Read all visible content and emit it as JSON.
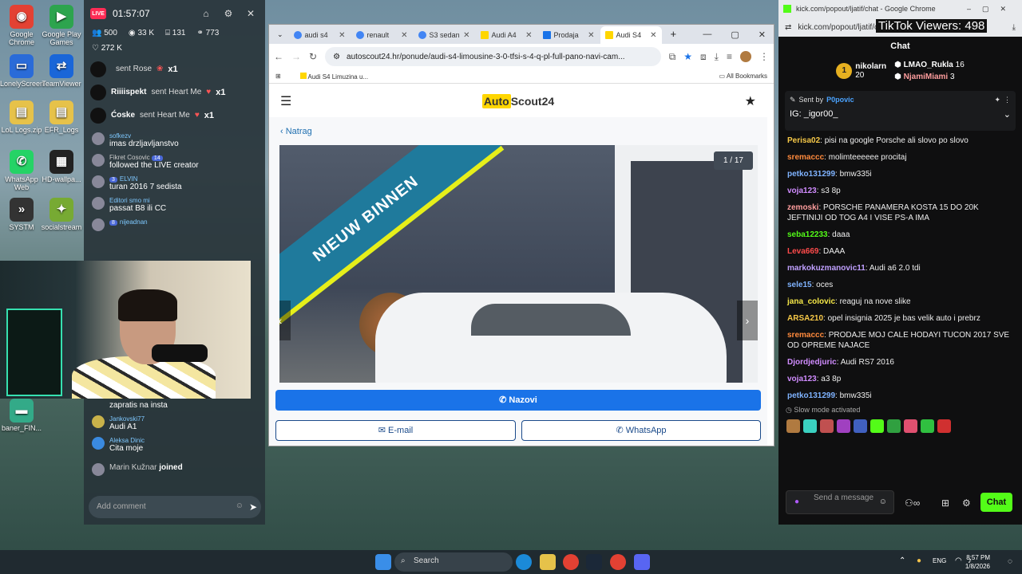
{
  "desktop": {
    "icons": [
      {
        "label": "Google Chrome",
        "color": "#e34133",
        "glyph": "◉"
      },
      {
        "label": "Google Play Games",
        "color": "#2da44e",
        "glyph": "▶"
      },
      {
        "label": "LonelyScreen",
        "color": "#2a6bd8",
        "glyph": "▭"
      },
      {
        "label": "TeamViewer",
        "color": "#1a66d8",
        "glyph": "⇄"
      },
      {
        "label": "LoL Logs.zip",
        "color": "#e6c24a",
        "glyph": "▤"
      },
      {
        "label": "EFR_Logs",
        "color": "#e6c24a",
        "glyph": "▤"
      },
      {
        "label": "WhatsApp Web",
        "color": "#25d366",
        "glyph": "✆"
      },
      {
        "label": "HD-wallpa...",
        "color": "#222",
        "glyph": "▦"
      },
      {
        "label": "SYSTM",
        "color": "#333",
        "glyph": "»"
      },
      {
        "label": "socialstream",
        "color": "#7a3",
        "glyph": "✦"
      },
      {
        "label": "baner_FIN...",
        "color": "#3a8",
        "glyph": "▬"
      }
    ]
  },
  "tiktok": {
    "live": "LIVE",
    "time": "01:57:07",
    "stats": {
      "viewers": "500",
      "views": "33 K",
      "gifts": "131",
      "followers": "773"
    },
    "likes": "272 K",
    "gifts": [
      {
        "user": "",
        "text": "sent Rose",
        "count": "x1"
      },
      {
        "user": "Riiiispekt",
        "text": "sent Heart Me",
        "count": "x1"
      },
      {
        "user": "Ćoske",
        "text": "sent Heart Me",
        "count": "x1"
      }
    ],
    "comments": [
      {
        "user": "sofkezv",
        "text": "imas drzljavljanstvo",
        "badge": ""
      },
      {
        "user": "Fikret Cosovic",
        "text": "followed the LIVE creator",
        "badge": "14"
      },
      {
        "user": "ELVIN",
        "text": "turan 2016 7 sedista",
        "badge": "3"
      },
      {
        "user": "Editori smo mi",
        "text": "passat B8 ili CC",
        "badge": ""
      },
      {
        "user": "nijeadnan",
        "text": "",
        "badge": "8"
      }
    ],
    "comments_bottom": [
      {
        "user": "",
        "text": "zapratis na insta"
      },
      {
        "user": "Jankovski77",
        "text": "Audi A1"
      },
      {
        "user": "Aleksa Dinic",
        "text": "Cita moje"
      },
      {
        "user": "Marin Kužnar",
        "text": "joined"
      }
    ],
    "add_comment_placeholder": "Add comment"
  },
  "browser": {
    "tabs": [
      {
        "label": "audi s4",
        "color": "#4285f4"
      },
      {
        "label": "renault",
        "color": "#4285f4"
      },
      {
        "label": "S3 sedan",
        "color": "#4285f4"
      },
      {
        "label": "Audi A4",
        "color": "#ffd600"
      },
      {
        "label": "Prodaja",
        "color": "#1a73e8"
      },
      {
        "label": "Audi S4",
        "color": "#ffd600"
      }
    ],
    "url": "autoscout24.hr/ponude/audi-s4-limousine-3-0-tfsi-s-4-q-pl-full-pano-navi-cam...",
    "bookmark": "Audi S4 Limuzina u...",
    "all_bookmarks": "All Bookmarks",
    "site": {
      "logo_a": "Auto",
      "logo_b": "Scout24",
      "back": "Natrag",
      "banner": "NIEUW BINNEN",
      "counter": "1 / 17",
      "call": "Nazovi",
      "email": "E-mail",
      "whatsapp": "WhatsApp"
    }
  },
  "kick": {
    "window_title": "kick.com/popout/ljatif/chat - Google Chrome",
    "address": "kick.com/popout/ljatif/c",
    "overlay": "TikTok Viewers: 498",
    "chat_title": "Chat",
    "leaderboard": [
      {
        "rank": "1",
        "name": "nikolarn",
        "score": "20"
      },
      {
        "rank": "",
        "name": "LMAO_Rukla",
        "score": "16"
      },
      {
        "rank": "",
        "name": "NjamiMiami",
        "score": "3"
      }
    ],
    "pinned": {
      "sent_by_label": "Sent by",
      "user": "P0povic",
      "text": "IG: _igor00_"
    },
    "messages": [
      {
        "user": "Perisa02",
        "text": "pisi na google Porsche ali slovo po slovo",
        "color": "#f7c948"
      },
      {
        "user": "sremaccc",
        "text": "molimteeeeee procitaj",
        "color": "#ff8a3d"
      },
      {
        "user": "petko131299",
        "text": "bmw335i",
        "color": "#7fb3ff"
      },
      {
        "user": "voja123",
        "text": "s3 8p",
        "color": "#d08cff"
      },
      {
        "user": "zemoski",
        "text": "PORSCHE PANAMERA KOSTA 15 DO 20K JEFTINIJI OD TOG A4 I VISE PS-A IMA",
        "color": "#ff9e9e"
      },
      {
        "user": "seba12233",
        "text": "daaa",
        "color": "#53fc18"
      },
      {
        "user": "Leva669",
        "text": "DAAA",
        "color": "#ff4b4b"
      },
      {
        "user": "markokuzmanovic11",
        "text": "Audi a6 2.0 tdi",
        "color": "#c0a0ff"
      },
      {
        "user": "sele15",
        "text": "oces",
        "color": "#7fb3ff"
      },
      {
        "user": "jana_colovic",
        "text": "reaguj na nove slike",
        "color": "#f7e948"
      },
      {
        "user": "ARSA210",
        "text": "opel insignia 2025 je bas velik auto i prebrz",
        "color": "#f7c948"
      },
      {
        "user": "sremaccc",
        "text": "PRODAJE MOJ CALE HODAYI TUCON 2017 SVE OD OPREME NAJACE",
        "color": "#ff8a3d"
      },
      {
        "user": "Djordjedjuric",
        "text": "Audi RS7 2016",
        "color": "#d08cff"
      },
      {
        "user": "voja123",
        "text": "a3 8p",
        "color": "#d08cff"
      },
      {
        "user": "petko131299",
        "text": "bmw335i",
        "color": "#7fb3ff"
      }
    ],
    "slow_mode": "Slow mode activated",
    "send_placeholder": "Send a message",
    "chat_button": "Chat"
  },
  "taskbar": {
    "search": "Search",
    "lang": "ENG",
    "time": "8:57 PM",
    "date": "1/8/2026"
  }
}
